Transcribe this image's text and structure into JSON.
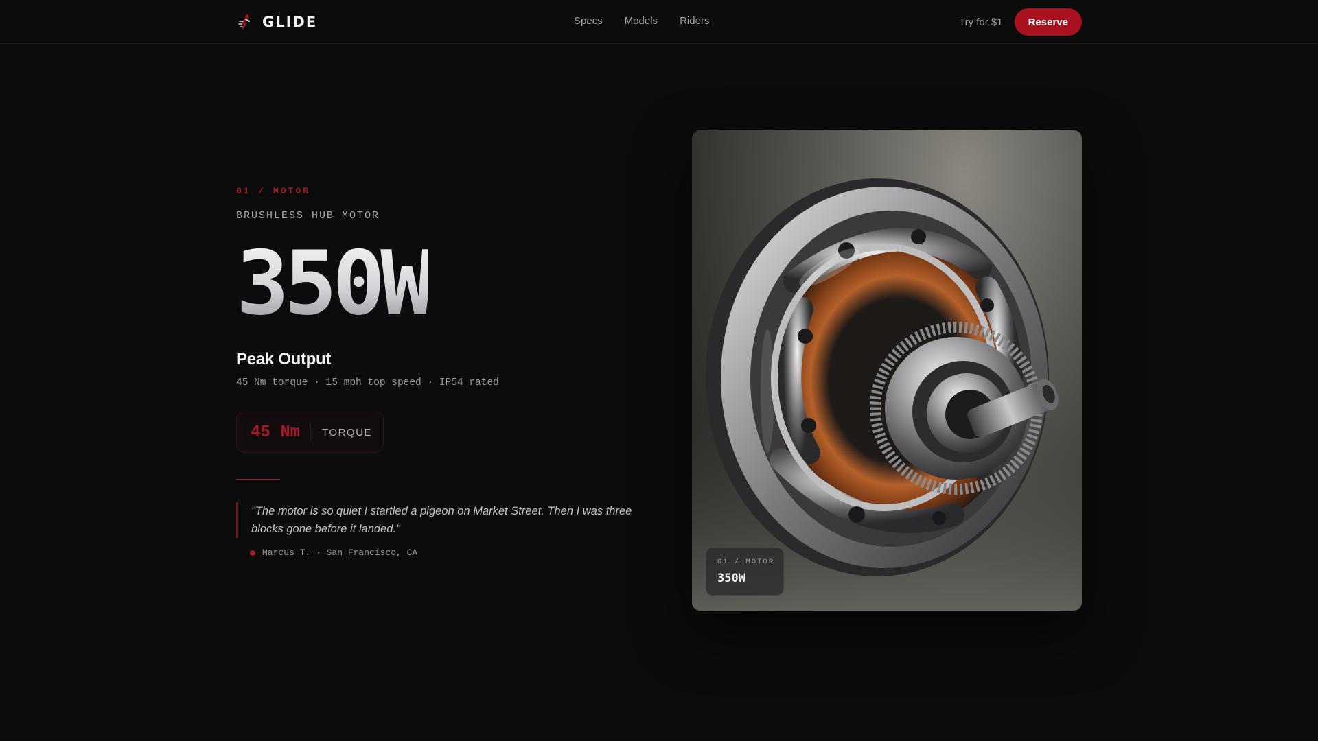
{
  "nav": {
    "brand": "GLIDE",
    "links": [
      "Specs",
      "Models",
      "Riders"
    ],
    "try_label": "Try for $1",
    "reserve_label": "Reserve"
  },
  "hero": {
    "eyebrow": "01 / MOTOR",
    "subhead": "BRUSHLESS HUB MOTOR",
    "value": "350W",
    "title": "Peak Output",
    "specs": "45 Nm torque · 15 mph top speed · IP54 rated",
    "badge": {
      "value": "45 Nm",
      "label": "TORQUE"
    },
    "quote": "\"The motor is so quiet I startled a pigeon on Market Street. Then I was three blocks gone before it landed.\"",
    "author": "Marcus T. · San Francisco, CA"
  },
  "image": {
    "tag_eyebrow": "01 / MOTOR",
    "tag_value": "350W"
  },
  "colors": {
    "background": "#0c0c0d",
    "accent": "#a8121f",
    "muted_text": "#a2a2a6"
  },
  "icons": {
    "brand": "scooter-rider-icon"
  }
}
